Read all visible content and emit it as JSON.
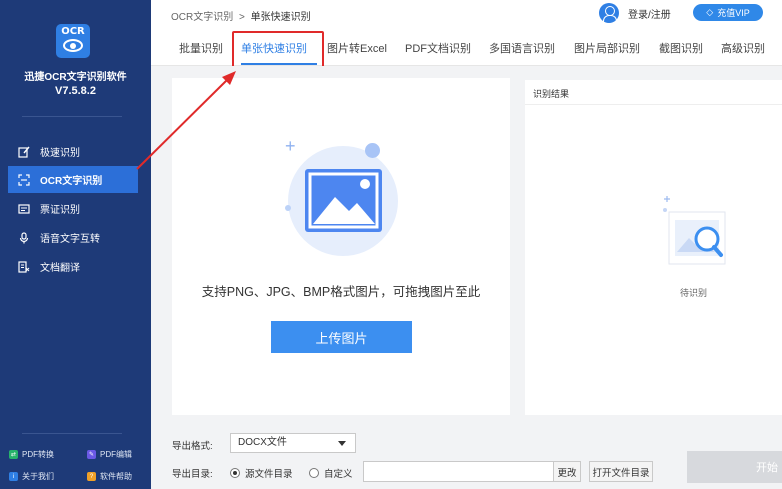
{
  "app": {
    "name": "迅捷OCR文字识别软件",
    "version": "V7.5.8.2",
    "logo_text": "OCR"
  },
  "sidebar": {
    "items": [
      {
        "label": "极速识别",
        "icon": "lightning-edit-icon",
        "active": false
      },
      {
        "label": "OCR文字识别",
        "icon": "scan-frame-icon",
        "active": true
      },
      {
        "label": "票证识别",
        "icon": "ticket-icon",
        "active": false
      },
      {
        "label": "语音文字互转",
        "icon": "microphone-icon",
        "active": false
      },
      {
        "label": "文档翻译",
        "icon": "translate-document-icon",
        "active": false
      }
    ],
    "bottom_links": [
      {
        "label": "PDF转换",
        "color": "#27b36b"
      },
      {
        "label": "PDF编辑",
        "color": "#6b59e6"
      },
      {
        "label": "关于我们",
        "color": "#2f7fe4"
      },
      {
        "label": "软件帮助",
        "color": "#f0a028"
      }
    ]
  },
  "topbar": {
    "breadcrumb_root": "OCR文字识别",
    "breadcrumb_sep": ">",
    "breadcrumb_current": "单张快速识别",
    "login_label": "登录/注册",
    "vip_label": "充值VIP"
  },
  "tabs": [
    {
      "label": "批量识别",
      "active": false
    },
    {
      "label": "单张快速识别",
      "active": true
    },
    {
      "label": "图片转Excel",
      "active": false
    },
    {
      "label": "PDF文档识别",
      "active": false
    },
    {
      "label": "多国语言识别",
      "active": false
    },
    {
      "label": "图片局部识别",
      "active": false
    },
    {
      "label": "截图识别",
      "active": false
    },
    {
      "label": "高级识别",
      "active": false
    }
  ],
  "upload": {
    "hint": "支持PNG、JPG、BMP格式图片，可拖拽图片至此",
    "button_label": "上传图片"
  },
  "result": {
    "title": "识别结果",
    "pending_label": "待识别"
  },
  "export": {
    "format_label": "导出格式:",
    "format_value": "DOCX文件",
    "dir_label": "导出目录:",
    "option_source": "源文件目录",
    "option_custom": "自定义",
    "selected_option": "source",
    "path_value": "",
    "change_label": "更改",
    "open_dir_label": "打开文件目录",
    "start_label": "开始"
  },
  "colors": {
    "sidebar_bg": "#1e3a78",
    "accent": "#2f7fe4",
    "highlight": "#e02a2a"
  }
}
